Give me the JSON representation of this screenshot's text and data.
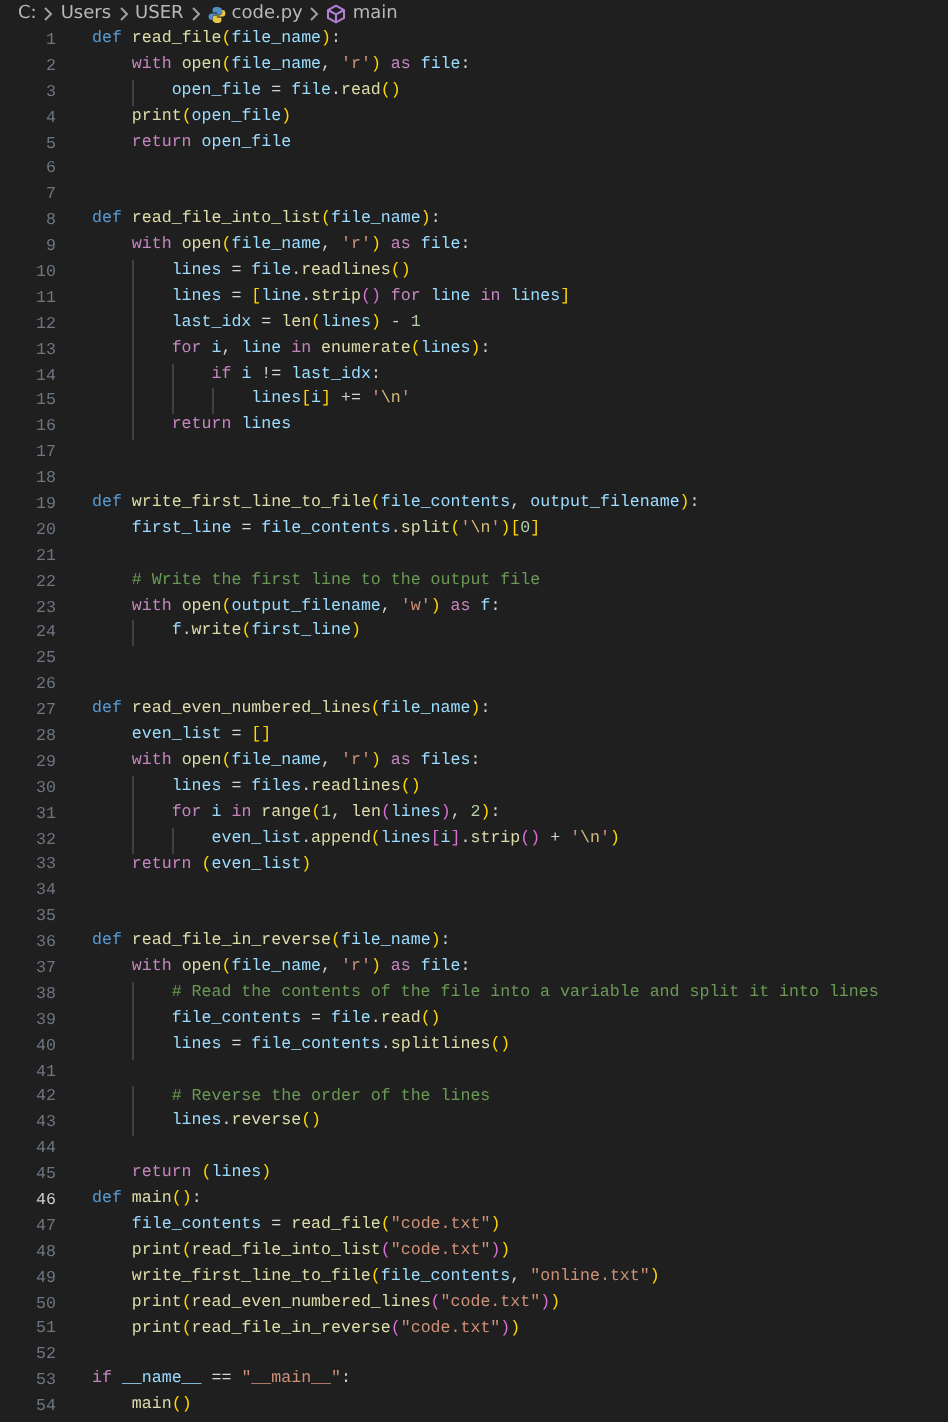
{
  "breadcrumb": [
    {
      "kind": "text",
      "text": "C:"
    },
    {
      "kind": "text",
      "text": "Users"
    },
    {
      "kind": "text",
      "text": "USER"
    },
    {
      "kind": "file",
      "text": "code.py"
    },
    {
      "kind": "symbol",
      "text": "main"
    }
  ],
  "lines": [
    {
      "number": "1",
      "current": false,
      "tokens": [
        {
          "kind": "def",
          "text": "def "
        },
        {
          "kind": "fn",
          "text": "read_file"
        },
        {
          "kind": "b1",
          "text": "("
        },
        {
          "kind": "var",
          "text": "file_name"
        },
        {
          "kind": "b1",
          "text": ")"
        },
        {
          "kind": "op",
          "text": ":"
        }
      ]
    },
    {
      "number": "2",
      "current": false,
      "tokens": [
        {
          "kind": "kw",
          "text": "    with "
        },
        {
          "kind": "fn",
          "text": "open"
        },
        {
          "kind": "b1",
          "text": "("
        },
        {
          "kind": "var",
          "text": "file_name"
        },
        {
          "kind": "op",
          "text": ", "
        },
        {
          "kind": "str",
          "text": "'r'"
        },
        {
          "kind": "b1",
          "text": ")"
        },
        {
          "kind": "kw",
          "text": " as "
        },
        {
          "kind": "var",
          "text": "file"
        },
        {
          "kind": "op",
          "text": ":"
        }
      ]
    },
    {
      "number": "3",
      "current": false,
      "tokens": [
        {
          "kind": "var",
          "text": "        open_file"
        },
        {
          "kind": "op",
          "text": " = "
        },
        {
          "kind": "var",
          "text": "file"
        },
        {
          "kind": "op",
          "text": "."
        },
        {
          "kind": "fn",
          "text": "read"
        },
        {
          "kind": "b1",
          "text": "()"
        }
      ]
    },
    {
      "number": "4",
      "current": false,
      "tokens": [
        {
          "kind": "fn",
          "text": "    print"
        },
        {
          "kind": "b1",
          "text": "("
        },
        {
          "kind": "var",
          "text": "open_file"
        },
        {
          "kind": "b1",
          "text": ")"
        }
      ]
    },
    {
      "number": "5",
      "current": false,
      "tokens": [
        {
          "kind": "kw",
          "text": "    return "
        },
        {
          "kind": "var",
          "text": "open_file"
        }
      ]
    },
    {
      "number": "6",
      "current": false
    },
    {
      "number": "7",
      "current": false
    },
    {
      "number": "8",
      "current": false,
      "tokens": [
        {
          "kind": "def",
          "text": "def "
        },
        {
          "kind": "fn",
          "text": "read_file_into_list"
        },
        {
          "kind": "b1",
          "text": "("
        },
        {
          "kind": "var",
          "text": "file_name"
        },
        {
          "kind": "b1",
          "text": ")"
        },
        {
          "kind": "op",
          "text": ":"
        }
      ]
    },
    {
      "number": "9",
      "current": false,
      "tokens": [
        {
          "kind": "kw",
          "text": "    with "
        },
        {
          "kind": "fn",
          "text": "open"
        },
        {
          "kind": "b1",
          "text": "("
        },
        {
          "kind": "var",
          "text": "file_name"
        },
        {
          "kind": "op",
          "text": ", "
        },
        {
          "kind": "str",
          "text": "'r'"
        },
        {
          "kind": "b1",
          "text": ")"
        },
        {
          "kind": "kw",
          "text": " as "
        },
        {
          "kind": "var",
          "text": "file"
        },
        {
          "kind": "op",
          "text": ":"
        }
      ]
    },
    {
      "number": "10",
      "current": false,
      "tokens": [
        {
          "kind": "var",
          "text": "        lines"
        },
        {
          "kind": "op",
          "text": " = "
        },
        {
          "kind": "var",
          "text": "file"
        },
        {
          "kind": "op",
          "text": "."
        },
        {
          "kind": "fn",
          "text": "readlines"
        },
        {
          "kind": "b1",
          "text": "()"
        }
      ]
    },
    {
      "number": "11",
      "current": false,
      "tokens": [
        {
          "kind": "var",
          "text": "        lines"
        },
        {
          "kind": "op",
          "text": " = "
        },
        {
          "kind": "b1",
          "text": "["
        },
        {
          "kind": "var",
          "text": "line"
        },
        {
          "kind": "op",
          "text": "."
        },
        {
          "kind": "fn",
          "text": "strip"
        },
        {
          "kind": "b2",
          "text": "()"
        },
        {
          "kind": "kw",
          "text": " for "
        },
        {
          "kind": "var",
          "text": "line"
        },
        {
          "kind": "kw",
          "text": " in "
        },
        {
          "kind": "var",
          "text": "lines"
        },
        {
          "kind": "b1",
          "text": "]"
        }
      ]
    },
    {
      "number": "12",
      "current": false,
      "tokens": [
        {
          "kind": "var",
          "text": "        last_idx"
        },
        {
          "kind": "op",
          "text": " = "
        },
        {
          "kind": "fn",
          "text": "len"
        },
        {
          "kind": "b1",
          "text": "("
        },
        {
          "kind": "var",
          "text": "lines"
        },
        {
          "kind": "b1",
          "text": ")"
        },
        {
          "kind": "op",
          "text": " - "
        },
        {
          "kind": "num",
          "text": "1"
        }
      ]
    },
    {
      "number": "13",
      "current": false,
      "tokens": [
        {
          "kind": "kw",
          "text": "        for "
        },
        {
          "kind": "var",
          "text": "i"
        },
        {
          "kind": "op",
          "text": ", "
        },
        {
          "kind": "var",
          "text": "line"
        },
        {
          "kind": "kw",
          "text": " in "
        },
        {
          "kind": "fn",
          "text": "enumerate"
        },
        {
          "kind": "b1",
          "text": "("
        },
        {
          "kind": "var",
          "text": "lines"
        },
        {
          "kind": "b1",
          "text": ")"
        },
        {
          "kind": "op",
          "text": ":"
        }
      ]
    },
    {
      "number": "14",
      "current": false,
      "tokens": [
        {
          "kind": "kw",
          "text": "            if "
        },
        {
          "kind": "var",
          "text": "i"
        },
        {
          "kind": "op",
          "text": " != "
        },
        {
          "kind": "var",
          "text": "last_idx"
        },
        {
          "kind": "op",
          "text": ":"
        }
      ]
    },
    {
      "number": "15",
      "current": false,
      "tokens": [
        {
          "kind": "var",
          "text": "                lines"
        },
        {
          "kind": "b1",
          "text": "["
        },
        {
          "kind": "var",
          "text": "i"
        },
        {
          "kind": "b1",
          "text": "]"
        },
        {
          "kind": "op",
          "text": " += "
        },
        {
          "kind": "str",
          "text": "'"
        },
        {
          "kind": "esc",
          "text": "\\n"
        },
        {
          "kind": "str",
          "text": "'"
        }
      ]
    },
    {
      "number": "16",
      "current": false,
      "tokens": [
        {
          "kind": "kw",
          "text": "        return "
        },
        {
          "kind": "var",
          "text": "lines"
        }
      ]
    },
    {
      "number": "17",
      "current": false
    },
    {
      "number": "18",
      "current": false
    },
    {
      "number": "19",
      "current": false,
      "tokens": [
        {
          "kind": "def",
          "text": "def "
        },
        {
          "kind": "fn",
          "text": "write_first_line_to_file"
        },
        {
          "kind": "b1",
          "text": "("
        },
        {
          "kind": "var",
          "text": "file_contents"
        },
        {
          "kind": "op",
          "text": ", "
        },
        {
          "kind": "var",
          "text": "output_filename"
        },
        {
          "kind": "b1",
          "text": ")"
        },
        {
          "kind": "op",
          "text": ":"
        }
      ]
    },
    {
      "number": "20",
      "current": false,
      "tokens": [
        {
          "kind": "var",
          "text": "    first_line"
        },
        {
          "kind": "op",
          "text": " = "
        },
        {
          "kind": "var",
          "text": "file_contents"
        },
        {
          "kind": "op",
          "text": "."
        },
        {
          "kind": "fn",
          "text": "split"
        },
        {
          "kind": "b1",
          "text": "("
        },
        {
          "kind": "str",
          "text": "'"
        },
        {
          "kind": "esc",
          "text": "\\n"
        },
        {
          "kind": "str",
          "text": "'"
        },
        {
          "kind": "b1",
          "text": ")"
        },
        {
          "kind": "b1",
          "text": "["
        },
        {
          "kind": "num",
          "text": "0"
        },
        {
          "kind": "b1",
          "text": "]"
        }
      ]
    },
    {
      "number": "21",
      "current": false
    },
    {
      "number": "22",
      "current": false,
      "tokens": [
        {
          "kind": "cmt",
          "text": "    # Write the first line to the output file"
        }
      ]
    },
    {
      "number": "23",
      "current": false,
      "tokens": [
        {
          "kind": "kw",
          "text": "    with "
        },
        {
          "kind": "fn",
          "text": "open"
        },
        {
          "kind": "b1",
          "text": "("
        },
        {
          "kind": "var",
          "text": "output_filename"
        },
        {
          "kind": "op",
          "text": ", "
        },
        {
          "kind": "str",
          "text": "'w'"
        },
        {
          "kind": "b1",
          "text": ")"
        },
        {
          "kind": "kw",
          "text": " as "
        },
        {
          "kind": "var",
          "text": "f"
        },
        {
          "kind": "op",
          "text": ":"
        }
      ]
    },
    {
      "number": "24",
      "current": false,
      "tokens": [
        {
          "kind": "var",
          "text": "        f"
        },
        {
          "kind": "op",
          "text": "."
        },
        {
          "kind": "fn",
          "text": "write"
        },
        {
          "kind": "b1",
          "text": "("
        },
        {
          "kind": "var",
          "text": "first_line"
        },
        {
          "kind": "b1",
          "text": ")"
        }
      ]
    },
    {
      "number": "25",
      "current": false
    },
    {
      "number": "26",
      "current": false
    },
    {
      "number": "27",
      "current": false,
      "tokens": [
        {
          "kind": "def",
          "text": "def "
        },
        {
          "kind": "fn",
          "text": "read_even_numbered_lines"
        },
        {
          "kind": "b1",
          "text": "("
        },
        {
          "kind": "var",
          "text": "file_name"
        },
        {
          "kind": "b1",
          "text": ")"
        },
        {
          "kind": "op",
          "text": ":"
        }
      ]
    },
    {
      "number": "28",
      "current": false,
      "tokens": [
        {
          "kind": "var",
          "text": "    even_list"
        },
        {
          "kind": "op",
          "text": " = "
        },
        {
          "kind": "b1",
          "text": "[]"
        }
      ]
    },
    {
      "number": "29",
      "current": false,
      "tokens": [
        {
          "kind": "kw",
          "text": "    with "
        },
        {
          "kind": "fn",
          "text": "open"
        },
        {
          "kind": "b1",
          "text": "("
        },
        {
          "kind": "var",
          "text": "file_name"
        },
        {
          "kind": "op",
          "text": ", "
        },
        {
          "kind": "str",
          "text": "'r'"
        },
        {
          "kind": "b1",
          "text": ")"
        },
        {
          "kind": "kw",
          "text": " as "
        },
        {
          "kind": "var",
          "text": "files"
        },
        {
          "kind": "op",
          "text": ":"
        }
      ]
    },
    {
      "number": "30",
      "current": false,
      "tokens": [
        {
          "kind": "var",
          "text": "        lines"
        },
        {
          "kind": "op",
          "text": " = "
        },
        {
          "kind": "var",
          "text": "files"
        },
        {
          "kind": "op",
          "text": "."
        },
        {
          "kind": "fn",
          "text": "readlines"
        },
        {
          "kind": "b1",
          "text": "()"
        }
      ]
    },
    {
      "number": "31",
      "current": false,
      "tokens": [
        {
          "kind": "kw",
          "text": "        for "
        },
        {
          "kind": "var",
          "text": "i"
        },
        {
          "kind": "kw",
          "text": " in "
        },
        {
          "kind": "fn",
          "text": "range"
        },
        {
          "kind": "b1",
          "text": "("
        },
        {
          "kind": "num",
          "text": "1"
        },
        {
          "kind": "op",
          "text": ", "
        },
        {
          "kind": "fn",
          "text": "len"
        },
        {
          "kind": "b2",
          "text": "("
        },
        {
          "kind": "var",
          "text": "lines"
        },
        {
          "kind": "b2",
          "text": ")"
        },
        {
          "kind": "op",
          "text": ", "
        },
        {
          "kind": "num",
          "text": "2"
        },
        {
          "kind": "b1",
          "text": ")"
        },
        {
          "kind": "op",
          "text": ":"
        }
      ]
    },
    {
      "number": "32",
      "current": false,
      "tokens": [
        {
          "kind": "var",
          "text": "            even_list"
        },
        {
          "kind": "op",
          "text": "."
        },
        {
          "kind": "fn",
          "text": "append"
        },
        {
          "kind": "b1",
          "text": "("
        },
        {
          "kind": "var",
          "text": "lines"
        },
        {
          "kind": "b2",
          "text": "["
        },
        {
          "kind": "var",
          "text": "i"
        },
        {
          "kind": "b2",
          "text": "]"
        },
        {
          "kind": "op",
          "text": "."
        },
        {
          "kind": "fn",
          "text": "strip"
        },
        {
          "kind": "b2",
          "text": "()"
        },
        {
          "kind": "op",
          "text": " + "
        },
        {
          "kind": "str",
          "text": "'"
        },
        {
          "kind": "esc",
          "text": "\\n"
        },
        {
          "kind": "str",
          "text": "'"
        },
        {
          "kind": "b1",
          "text": ")"
        }
      ]
    },
    {
      "number": "33",
      "current": false,
      "tokens": [
        {
          "kind": "kw",
          "text": "    return "
        },
        {
          "kind": "b1",
          "text": "("
        },
        {
          "kind": "var",
          "text": "even_list"
        },
        {
          "kind": "b1",
          "text": ")"
        }
      ]
    },
    {
      "number": "34",
      "current": false
    },
    {
      "number": "35",
      "current": false
    },
    {
      "number": "36",
      "current": false,
      "tokens": [
        {
          "kind": "def",
          "text": "def "
        },
        {
          "kind": "fn",
          "text": "read_file_in_reverse"
        },
        {
          "kind": "b1",
          "text": "("
        },
        {
          "kind": "var",
          "text": "file_name"
        },
        {
          "kind": "b1",
          "text": ")"
        },
        {
          "kind": "op",
          "text": ":"
        }
      ]
    },
    {
      "number": "37",
      "current": false,
      "tokens": [
        {
          "kind": "kw",
          "text": "    with "
        },
        {
          "kind": "fn",
          "text": "open"
        },
        {
          "kind": "b1",
          "text": "("
        },
        {
          "kind": "var",
          "text": "file_name"
        },
        {
          "kind": "op",
          "text": ", "
        },
        {
          "kind": "str",
          "text": "'r'"
        },
        {
          "kind": "b1",
          "text": ")"
        },
        {
          "kind": "kw",
          "text": " as "
        },
        {
          "kind": "var",
          "text": "file"
        },
        {
          "kind": "op",
          "text": ":"
        }
      ]
    },
    {
      "number": "38",
      "current": false,
      "tokens": [
        {
          "kind": "cmt",
          "text": "        # Read the contents of the file into a variable and split it into lines"
        }
      ]
    },
    {
      "number": "39",
      "current": false,
      "tokens": [
        {
          "kind": "var",
          "text": "        file_contents"
        },
        {
          "kind": "op",
          "text": " = "
        },
        {
          "kind": "var",
          "text": "file"
        },
        {
          "kind": "op",
          "text": "."
        },
        {
          "kind": "fn",
          "text": "read"
        },
        {
          "kind": "b1",
          "text": "()"
        }
      ]
    },
    {
      "number": "40",
      "current": false,
      "tokens": [
        {
          "kind": "var",
          "text": "        lines"
        },
        {
          "kind": "op",
          "text": " = "
        },
        {
          "kind": "var",
          "text": "file_contents"
        },
        {
          "kind": "op",
          "text": "."
        },
        {
          "kind": "fn",
          "text": "splitlines"
        },
        {
          "kind": "b1",
          "text": "()"
        }
      ]
    },
    {
      "number": "41",
      "current": false
    },
    {
      "number": "42",
      "current": false,
      "tokens": [
        {
          "kind": "cmt",
          "text": "        # Reverse the order of the lines"
        }
      ]
    },
    {
      "number": "43",
      "current": false,
      "tokens": [
        {
          "kind": "var",
          "text": "        lines"
        },
        {
          "kind": "op",
          "text": "."
        },
        {
          "kind": "fn",
          "text": "reverse"
        },
        {
          "kind": "b1",
          "text": "()"
        }
      ]
    },
    {
      "number": "44",
      "current": false
    },
    {
      "number": "45",
      "current": false,
      "tokens": [
        {
          "kind": "kw",
          "text": "    return "
        },
        {
          "kind": "b1",
          "text": "("
        },
        {
          "kind": "var",
          "text": "lines"
        },
        {
          "kind": "b1",
          "text": ")"
        }
      ]
    },
    {
      "number": "46",
      "current": true,
      "tokens": [
        {
          "kind": "def",
          "text": "def "
        },
        {
          "kind": "fn",
          "text": "main"
        },
        {
          "kind": "b1",
          "text": "()"
        },
        {
          "kind": "op",
          "text": ":"
        }
      ]
    },
    {
      "number": "47",
      "current": false,
      "tokens": [
        {
          "kind": "var",
          "text": "    file_contents"
        },
        {
          "kind": "op",
          "text": " = "
        },
        {
          "kind": "fn",
          "text": "read_file"
        },
        {
          "kind": "b1",
          "text": "("
        },
        {
          "kind": "str",
          "text": "\"code.txt\""
        },
        {
          "kind": "b1",
          "text": ")"
        }
      ]
    },
    {
      "number": "48",
      "current": false,
      "tokens": [
        {
          "kind": "fn",
          "text": "    print"
        },
        {
          "kind": "b1",
          "text": "("
        },
        {
          "kind": "fn",
          "text": "read_file_into_list"
        },
        {
          "kind": "b2",
          "text": "("
        },
        {
          "kind": "str",
          "text": "\"code.txt\""
        },
        {
          "kind": "b2",
          "text": ")"
        },
        {
          "kind": "b1",
          "text": ")"
        }
      ]
    },
    {
      "number": "49",
      "current": false,
      "tokens": [
        {
          "kind": "fn",
          "text": "    write_first_line_to_file"
        },
        {
          "kind": "b1",
          "text": "("
        },
        {
          "kind": "var",
          "text": "file_contents"
        },
        {
          "kind": "op",
          "text": ", "
        },
        {
          "kind": "str",
          "text": "\"online.txt\""
        },
        {
          "kind": "b1",
          "text": ")"
        }
      ]
    },
    {
      "number": "50",
      "current": false,
      "tokens": [
        {
          "kind": "fn",
          "text": "    print"
        },
        {
          "kind": "b1",
          "text": "("
        },
        {
          "kind": "fn",
          "text": "read_even_numbered_lines"
        },
        {
          "kind": "b2",
          "text": "("
        },
        {
          "kind": "str",
          "text": "\"code.txt\""
        },
        {
          "kind": "b2",
          "text": ")"
        },
        {
          "kind": "b1",
          "text": ")"
        }
      ]
    },
    {
      "number": "51",
      "current": false,
      "tokens": [
        {
          "kind": "fn",
          "text": "    print"
        },
        {
          "kind": "b1",
          "text": "("
        },
        {
          "kind": "fn",
          "text": "read_file_in_reverse"
        },
        {
          "kind": "b2",
          "text": "("
        },
        {
          "kind": "str",
          "text": "\"code.txt\""
        },
        {
          "kind": "b2",
          "text": ")"
        },
        {
          "kind": "b1",
          "text": ")"
        }
      ]
    },
    {
      "number": "52",
      "current": false
    },
    {
      "number": "53",
      "current": false,
      "tokens": [
        {
          "kind": "kw",
          "text": "if "
        },
        {
          "kind": "var",
          "text": "__name__"
        },
        {
          "kind": "op",
          "text": " == "
        },
        {
          "kind": "str",
          "text": "\"__main__\""
        },
        {
          "kind": "op",
          "text": ":"
        }
      ]
    },
    {
      "number": "54",
      "current": false,
      "tokens": [
        {
          "kind": "fn",
          "text": "    main"
        },
        {
          "kind": "b1",
          "text": "()"
        }
      ]
    }
  ]
}
